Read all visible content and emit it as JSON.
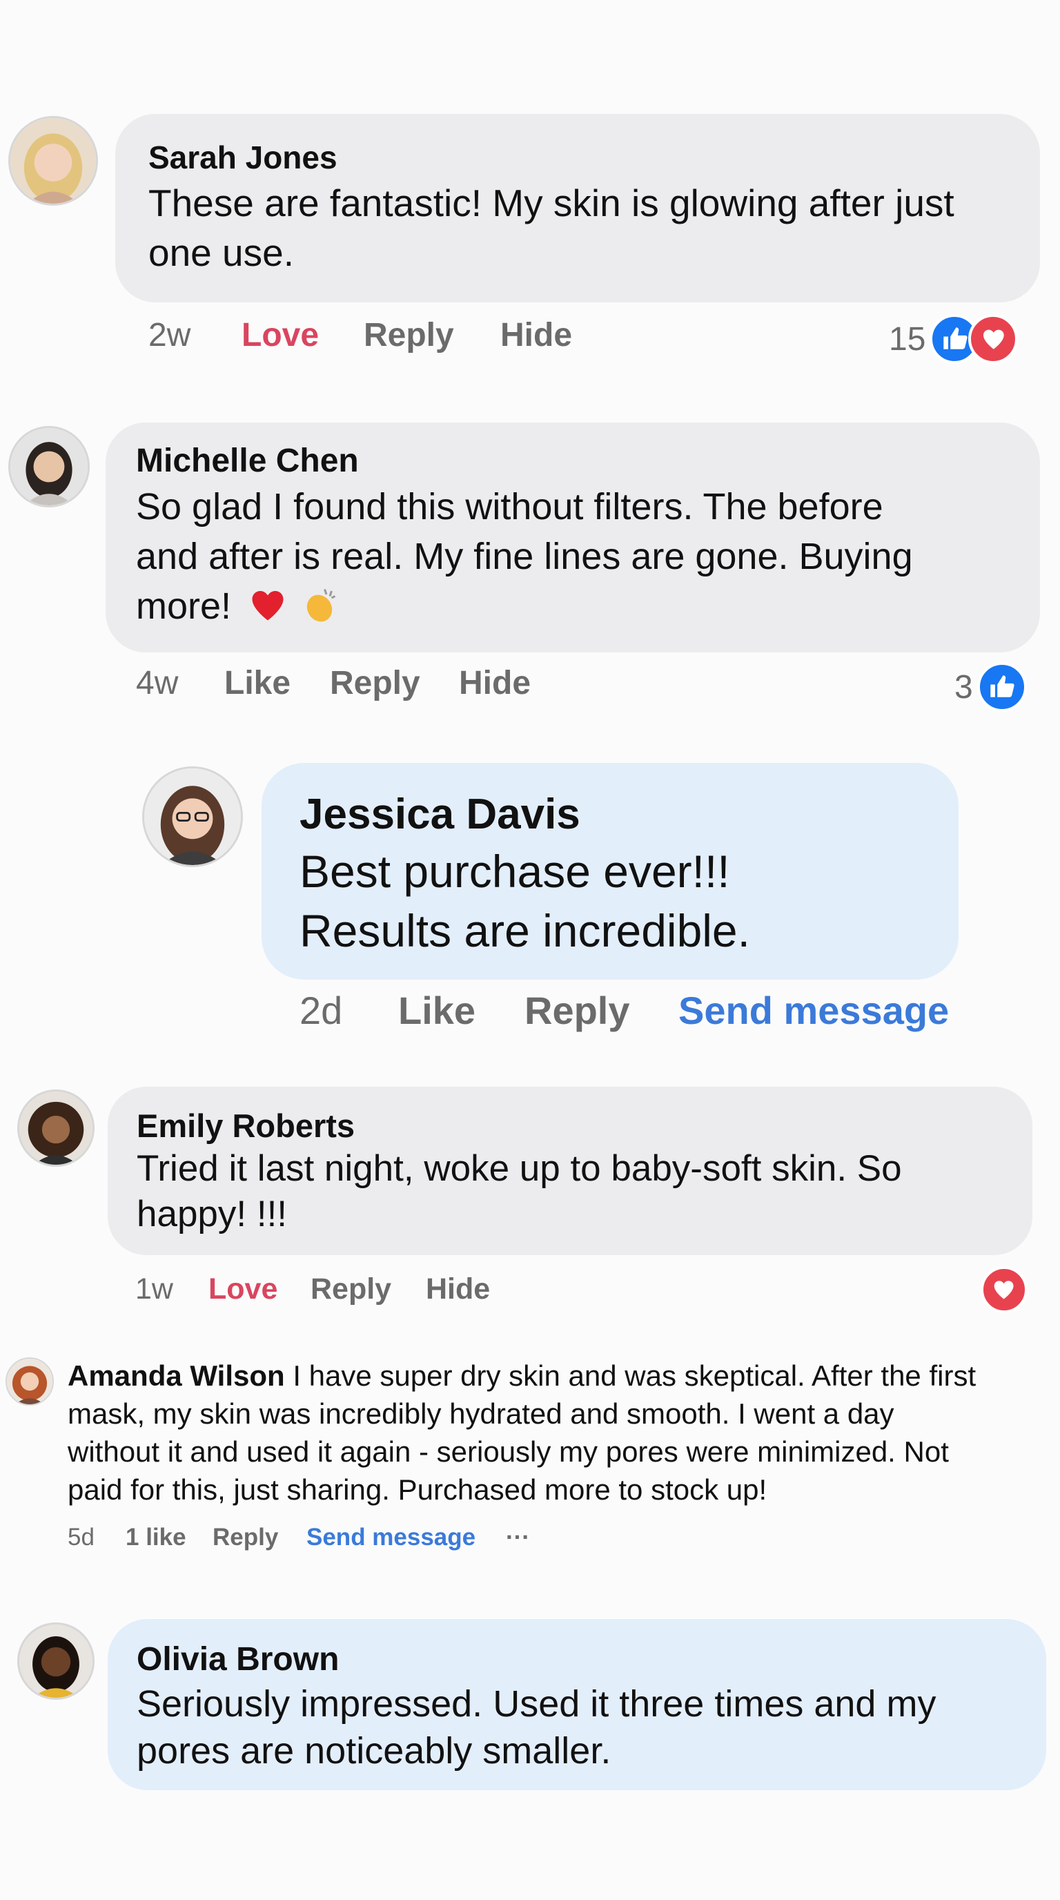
{
  "comments": [
    {
      "author": "Sarah Jones",
      "text_lines": [
        "These are fantastic! My skin is glowing after just",
        "one use."
      ],
      "time": "2w",
      "action1": "Love",
      "reply": "Reply",
      "extra": "Hide",
      "reaction_count": "15",
      "reactions": [
        "like-icon",
        "love-icon"
      ]
    },
    {
      "author": "Michelle Chen",
      "text_lines": [
        "So glad I found this without filters. The before",
        "and after is real. My fine lines are gone. Buying",
        "more!"
      ],
      "emojis": [
        "red-heart-emoji",
        "clapping-hands-emoji"
      ],
      "time": "4w",
      "action1": "Like",
      "reply": "Reply",
      "extra": "Hide",
      "reaction_count": "3",
      "reactions": [
        "like-icon"
      ]
    },
    {
      "author": "Jessica Davis",
      "text_lines": [
        "Best purchase ever!!!",
        "Results are incredible."
      ],
      "time": "2d",
      "action1": "Like",
      "reply": "Reply",
      "extra": "Send message"
    },
    {
      "author": "Emily Roberts",
      "text_lines": [
        "Tried it last night, woke up to baby-soft skin. So",
        "happy! !!!"
      ],
      "time": "1w",
      "action1": "Love",
      "reply": "Reply",
      "extra": "Hide",
      "reactions": [
        "love-icon"
      ]
    },
    {
      "author": "Amanda Wilson",
      "text_lines": [
        " I have super dry skin and was skeptical. After the first",
        "mask, my skin was incredibly hydrated and smooth. I went a day",
        "without it and used it again - seriously my pores were minimized. Not",
        "paid for this, just sharing. Purchased more to stock up!"
      ],
      "time": "5d",
      "likes": "1 like",
      "reply": "Reply",
      "extra": "Send message",
      "more": "···"
    },
    {
      "author": "Olivia Brown",
      "text_lines": [
        "Seriously impressed. Used it three times and my",
        "pores are noticeably smaller."
      ]
    }
  ],
  "colors": {
    "bubble_gray": "#ececee",
    "bubble_blue": "#e3eefb",
    "love_text": "#d9455f",
    "link_blue": "#3b7ad9",
    "like_blue": "#1877f2",
    "love_red": "#e8424f"
  }
}
